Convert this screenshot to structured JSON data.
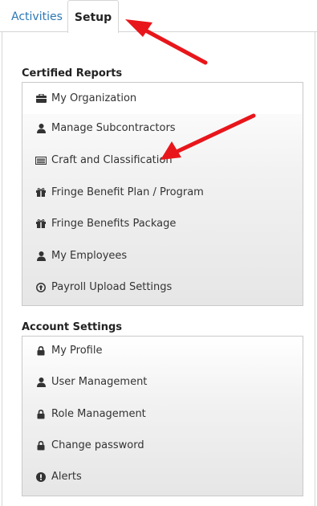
{
  "tabs": [
    {
      "label": "Activities",
      "active": false
    },
    {
      "label": "Setup",
      "active": true
    }
  ],
  "certified_reports": {
    "title": "Certified Reports",
    "items": [
      {
        "label": "My Organization",
        "icon": "briefcase-icon"
      },
      {
        "label": "Manage Subcontractors",
        "icon": "user-icon"
      },
      {
        "label": "Craft and Classification",
        "icon": "list-card-icon"
      },
      {
        "label": "Fringe Benefit Plan / Program",
        "icon": "gift-icon"
      },
      {
        "label": "Fringe Benefits Package",
        "icon": "gift-icon"
      },
      {
        "label": "My Employees",
        "icon": "user-icon"
      },
      {
        "label": "Payroll Upload Settings",
        "icon": "upload-circle-icon"
      }
    ]
  },
  "account_settings": {
    "title": "Account Settings",
    "items": [
      {
        "label": "My Profile",
        "icon": "lock-icon"
      },
      {
        "label": "User Management",
        "icon": "user-icon"
      },
      {
        "label": "Role Management",
        "icon": "lock-icon"
      },
      {
        "label": "Change password",
        "icon": "lock-icon"
      },
      {
        "label": "Alerts",
        "icon": "exclamation-circle-icon"
      }
    ]
  },
  "colors": {
    "tab_link": "#2b78b5",
    "annotation_arrow": "#e8161b"
  }
}
